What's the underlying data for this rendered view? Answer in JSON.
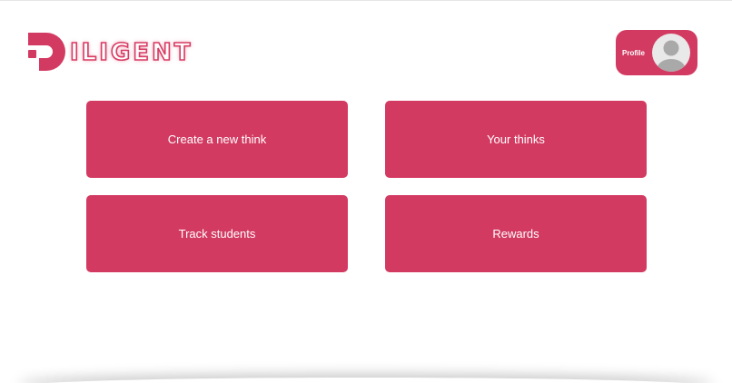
{
  "brand": {
    "name": "ILIGENT",
    "accent": "#d33a61"
  },
  "header": {
    "profile_label": "Profile"
  },
  "menu": {
    "items": [
      {
        "label": "Create a new think"
      },
      {
        "label": "Your thinks"
      },
      {
        "label": "Track students"
      },
      {
        "label": "Rewards"
      }
    ]
  },
  "icons": {
    "logo": "diligent-d-logo-icon",
    "avatar": "user-avatar-icon"
  }
}
